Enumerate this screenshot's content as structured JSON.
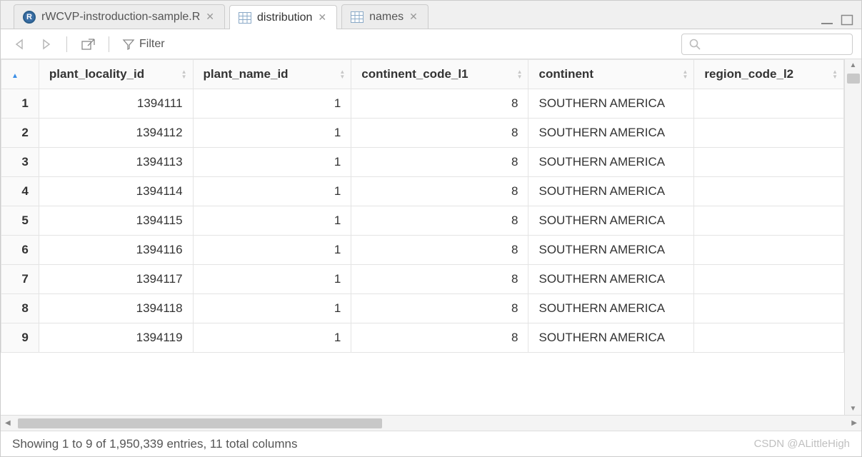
{
  "tabs": [
    {
      "label": "rWCVP-instroduction-sample.R",
      "type": "rscript",
      "active": false
    },
    {
      "label": "distribution",
      "type": "table",
      "active": true
    },
    {
      "label": "names",
      "type": "table",
      "active": false
    }
  ],
  "toolbar": {
    "filter_label": "Filter",
    "search_placeholder": ""
  },
  "columns": [
    {
      "name": "plant_locality_id",
      "align": "num"
    },
    {
      "name": "plant_name_id",
      "align": "num"
    },
    {
      "name": "continent_code_l1",
      "align": "num"
    },
    {
      "name": "continent",
      "align": "txt"
    },
    {
      "name": "region_code_l2",
      "align": "txt"
    }
  ],
  "rows": [
    {
      "n": "1",
      "plant_locality_id": "1394111",
      "plant_name_id": "1",
      "continent_code_l1": "8",
      "continent": "SOUTHERN AMERICA",
      "region_code_l2": ""
    },
    {
      "n": "2",
      "plant_locality_id": "1394112",
      "plant_name_id": "1",
      "continent_code_l1": "8",
      "continent": "SOUTHERN AMERICA",
      "region_code_l2": ""
    },
    {
      "n": "3",
      "plant_locality_id": "1394113",
      "plant_name_id": "1",
      "continent_code_l1": "8",
      "continent": "SOUTHERN AMERICA",
      "region_code_l2": ""
    },
    {
      "n": "4",
      "plant_locality_id": "1394114",
      "plant_name_id": "1",
      "continent_code_l1": "8",
      "continent": "SOUTHERN AMERICA",
      "region_code_l2": ""
    },
    {
      "n": "5",
      "plant_locality_id": "1394115",
      "plant_name_id": "1",
      "continent_code_l1": "8",
      "continent": "SOUTHERN AMERICA",
      "region_code_l2": ""
    },
    {
      "n": "6",
      "plant_locality_id": "1394116",
      "plant_name_id": "1",
      "continent_code_l1": "8",
      "continent": "SOUTHERN AMERICA",
      "region_code_l2": ""
    },
    {
      "n": "7",
      "plant_locality_id": "1394117",
      "plant_name_id": "1",
      "continent_code_l1": "8",
      "continent": "SOUTHERN AMERICA",
      "region_code_l2": ""
    },
    {
      "n": "8",
      "plant_locality_id": "1394118",
      "plant_name_id": "1",
      "continent_code_l1": "8",
      "continent": "SOUTHERN AMERICA",
      "region_code_l2": ""
    },
    {
      "n": "9",
      "plant_locality_id": "1394119",
      "plant_name_id": "1",
      "continent_code_l1": "8",
      "continent": "SOUTHERN AMERICA",
      "region_code_l2": ""
    }
  ],
  "status": {
    "text": "Showing 1 to 9 of 1,950,339 entries, 11 total columns"
  },
  "watermark": "CSDN @ALittleHigh"
}
